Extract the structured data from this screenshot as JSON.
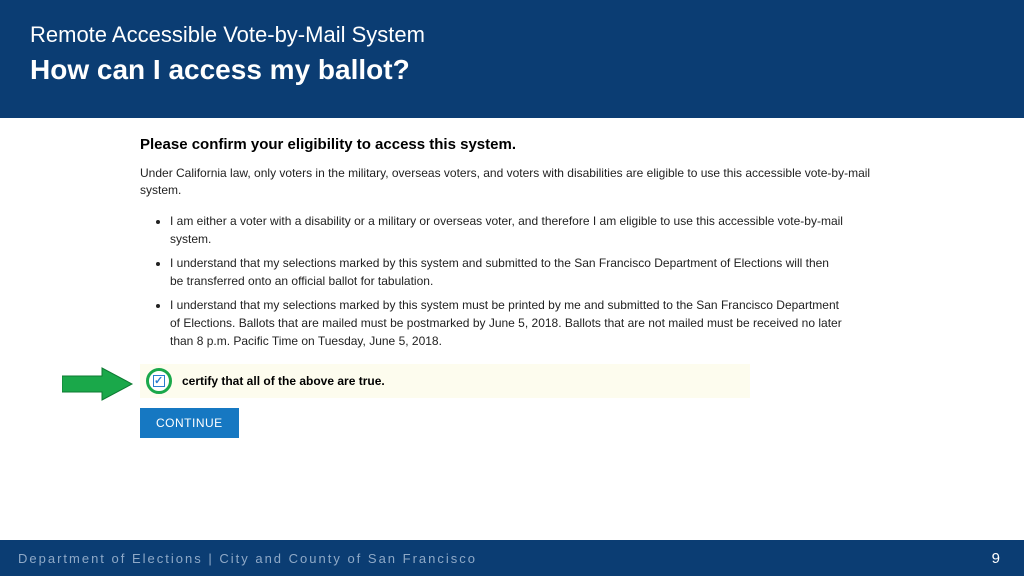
{
  "header": {
    "subtitle": "Remote Accessible Vote-by-Mail System",
    "title": "How can I access my ballot?"
  },
  "content": {
    "heading": "Please confirm your eligibility to access this system.",
    "intro": "Under California law, only voters in the military, overseas voters, and voters with disabilities are eligible to use this accessible vote-by-mail system.",
    "bullets": [
      "I am either a voter with a disability or a military or overseas voter, and therefore I am eligible to use this accessible vote-by-mail system.",
      "I understand that my selections marked by this system and submitted to the San Francisco Department of Elections will then be transferred onto an official ballot for tabulation.",
      "I understand that my selections marked by this system must be printed by me and submitted to the San Francisco Department of Elections. Ballots that are mailed must be postmarked by June 5, 2018. Ballots that are not mailed must be received no later than 8 p.m. Pacific Time on Tuesday, June 5, 2018."
    ],
    "certify_label": "certify that all of the above are true.",
    "continue_label": "CONTINUE"
  },
  "footer": {
    "text": "Department of Elections | City and County of San Francisco",
    "page_number": "9"
  },
  "colors": {
    "brand_blue": "#0b3d73",
    "button_blue": "#1678c2",
    "accent_green": "#1aa84a",
    "highlight_cream": "#fdfcee"
  }
}
